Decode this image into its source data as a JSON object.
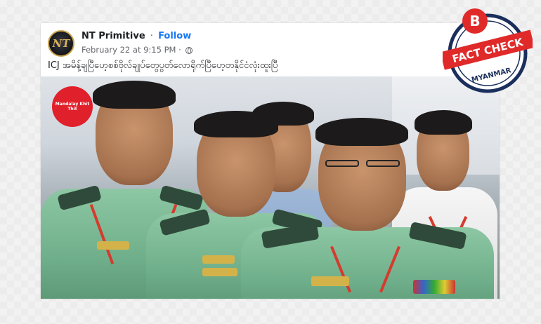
{
  "post": {
    "author": "NT Primitive",
    "separator": "·",
    "follow_label": "Follow",
    "timestamp": "February 22 at 9:15 PM",
    "timestamp_separator": "·",
    "avatar_text": "NT",
    "caption": "ICJ အမိန့်ချပြီဟေ့စစ်ဗိုလ်ချုပ်တွေပွတ်လောရိုက်ပြီဟေ့တနိုင်ငံလုံးထူးပြီ"
  },
  "photo": {
    "watermark_logo": "Mandalay Khit Thit",
    "icons": {
      "watermark": "mandalay-khit-thit-logo",
      "privacy": "globe-icon",
      "avatar": "nt-logo"
    }
  },
  "fact_check_badge": {
    "letter": "B",
    "label": "FACT CHECK",
    "region": "MYANMAR",
    "colors": {
      "red": "#e02a2a",
      "navy": "#1b2f5c"
    }
  }
}
